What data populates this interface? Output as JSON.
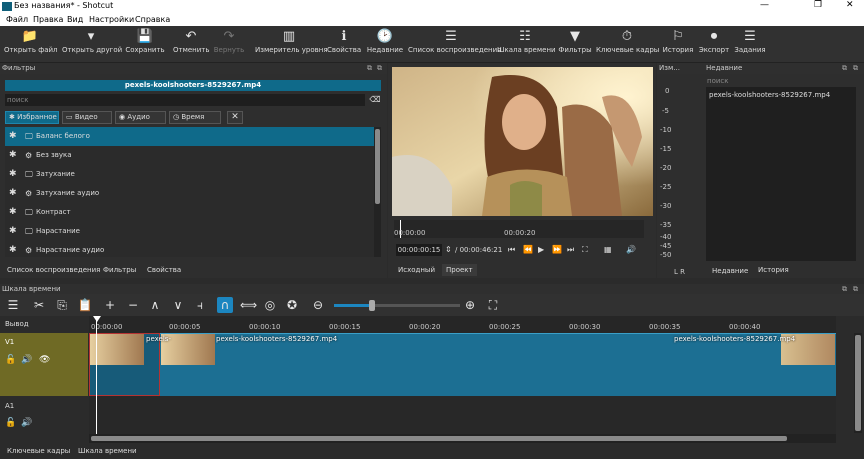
{
  "window": {
    "title": "Без названия* - Shotcut",
    "minimize": "—",
    "maximize": "❐",
    "close": "✕"
  },
  "menu": [
    "Файл",
    "Правка",
    "Вид",
    "Настройки",
    "Справка"
  ],
  "toolbar": [
    {
      "label": "Открыть файл",
      "icon": "folder-open-icon",
      "glyph": "📁"
    },
    {
      "label": "Открыть другой",
      "icon": "open-other-icon",
      "glyph": "▾"
    },
    {
      "label": "Сохранить",
      "icon": "save-icon",
      "glyph": "💾"
    },
    {
      "label": "Отменить",
      "icon": "undo-icon",
      "glyph": "↶"
    },
    {
      "label": "Вернуть",
      "icon": "redo-icon",
      "glyph": "↷",
      "disabled": true
    },
    {
      "label": "Измеритель уровня",
      "icon": "level-meter-icon",
      "glyph": "▥"
    },
    {
      "label": "Свойства",
      "icon": "properties-icon",
      "glyph": "ℹ"
    },
    {
      "label": "Недавние",
      "icon": "recent-icon",
      "glyph": "🕑"
    },
    {
      "label": "Список воспроизведения",
      "icon": "playlist-icon",
      "glyph": "☰"
    },
    {
      "label": "Шкала времени",
      "icon": "timeline-icon",
      "glyph": "☷"
    },
    {
      "label": "Фильтры",
      "icon": "filter-icon",
      "glyph": "▼"
    },
    {
      "label": "Ключевые кадры",
      "icon": "keyframes-icon",
      "glyph": "⏱"
    },
    {
      "label": "История",
      "icon": "history-icon",
      "glyph": "⚐"
    },
    {
      "label": "Экспорт",
      "icon": "export-icon",
      "glyph": "⏺"
    },
    {
      "label": "Задания",
      "icon": "jobs-icon",
      "glyph": "☰"
    }
  ],
  "filters_panel": {
    "title": "Фильтры",
    "clip_name": "pexels-koolshooters-8529267.mp4",
    "search_placeholder": "поиск",
    "tabs": [
      "Избранное",
      "Видео",
      "Аудио",
      "Время"
    ],
    "items": [
      {
        "label": "Баланс белого",
        "icon": "monitor-icon",
        "glyph": "🖵"
      },
      {
        "label": "Без звука",
        "icon": "speaker-icon",
        "glyph": "⚙"
      },
      {
        "label": "Затухание",
        "icon": "monitor-icon",
        "glyph": "🖵"
      },
      {
        "label": "Затухание аудио",
        "icon": "speaker-icon",
        "glyph": "⚙"
      },
      {
        "label": "Контраст",
        "icon": "monitor-icon",
        "glyph": "🖵"
      },
      {
        "label": "Нарастание",
        "icon": "monitor-icon",
        "glyph": "🖵"
      },
      {
        "label": "Нарастание аудио",
        "icon": "speaker-icon",
        "glyph": "⚙"
      }
    ],
    "bottom_tabs": [
      "Список воспроизведения",
      "Фильтры",
      "Свойства"
    ]
  },
  "player": {
    "ruler": [
      "00:00:00",
      "00:00:20"
    ],
    "current_time": "00:00:00:15",
    "total_time": "/ 00:00:46:21",
    "tabs": [
      "Исходный",
      "Проект"
    ]
  },
  "meter": {
    "title": "Изм...",
    "ticks": [
      "0",
      "-5",
      "-10",
      "-15",
      "-20",
      "-25",
      "-30",
      "-35",
      "-40",
      "-45",
      "-50"
    ],
    "channels": "L R"
  },
  "recent": {
    "title": "Недавние",
    "search_placeholder": "поиск",
    "items": [
      "pexels-koolshooters-8529267.mp4"
    ],
    "tabs": [
      "Недавние",
      "История"
    ]
  },
  "timeline": {
    "title": "Шкала времени",
    "output_label": "Вывод",
    "tracks": [
      "V1",
      "A1"
    ],
    "ruler": [
      "00:00:00",
      "00:00:05",
      "00:00:10",
      "00:00:15",
      "00:00:20",
      "00:00:25",
      "00:00:30",
      "00:00:35",
      "00:00:40"
    ],
    "clip_labels": [
      "pexels-",
      "pexels-koolshooters-8529267.mp4",
      "pexels-koolshooters-8529267.mp4"
    ]
  },
  "bottom_tabs": [
    "Ключевые кадры",
    "Шкала времени"
  ],
  "colors": {
    "accent": "#0f6a8a",
    "track_header": "#6f6a25",
    "clip": "#1c6f93"
  }
}
